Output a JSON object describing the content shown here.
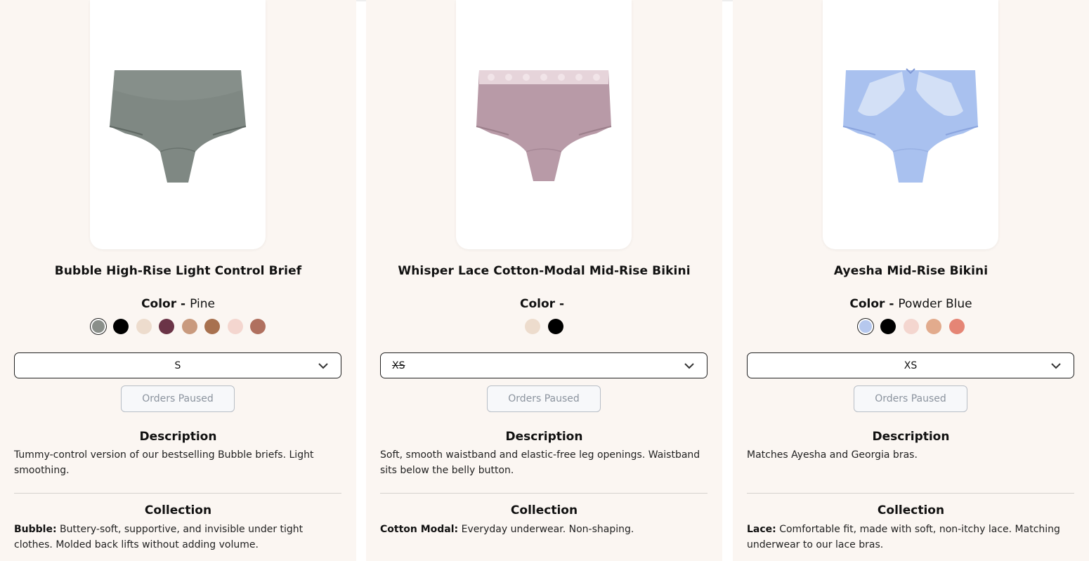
{
  "products": [
    {
      "title": "Bubble High-Rise Light Control Brief",
      "color_label": "Color -",
      "color_value": "Pine",
      "swatches": [
        "#8a8f8a",
        "#000000",
        "#eddccd",
        "#6b3447",
        "#c99a7e",
        "#a8714f",
        "#f4d6cf",
        "#b0705f"
      ],
      "selected_swatch": 0,
      "size_value": "S",
      "size_unavailable": false,
      "button_label": "Orders Paused",
      "description_heading": "Description",
      "description": "Tummy-control version of our bestselling Bubble briefs. Light smoothing.",
      "collection_heading": "Collection",
      "collection_name": "Bubble:",
      "collection_text": "Buttery-soft, supportive, and invisible under tight clothes. Molded back lifts without adding volume.",
      "product_color": "#7f8883"
    },
    {
      "title": "Whisper Lace Cotton-Modal Mid-Rise Bikini",
      "color_label": "Color -",
      "color_value": "",
      "swatches": [
        "#eddccd",
        "#000000"
      ],
      "selected_swatch": -1,
      "size_value": "XS",
      "size_unavailable": true,
      "button_label": "Orders Paused",
      "description_heading": "Description",
      "description": "Soft, smooth waistband and elastic-free leg openings. Waistband sits below the belly button.",
      "collection_heading": "Collection",
      "collection_name": "Cotton Modal:",
      "collection_text": "Everyday underwear. Non-shaping.",
      "product_color": "#b89aa7"
    },
    {
      "title": "Ayesha Mid-Rise Bikini",
      "color_label": "Color -",
      "color_value": "Powder Blue",
      "swatches": [
        "#b6c8ee",
        "#000000",
        "#f4d6cf",
        "#e2ab8d",
        "#e58575"
      ],
      "selected_swatch": 0,
      "size_value": "XS",
      "size_unavailable": false,
      "button_label": "Orders Paused",
      "description_heading": "Description",
      "description": "Matches Ayesha and Georgia bras.",
      "collection_heading": "Collection",
      "collection_name": "Lace:",
      "collection_text": "Comfortable fit, made with soft, non-itchy lace. Matching underwear to our lace bras.",
      "product_color": "#a9c1ef"
    }
  ]
}
